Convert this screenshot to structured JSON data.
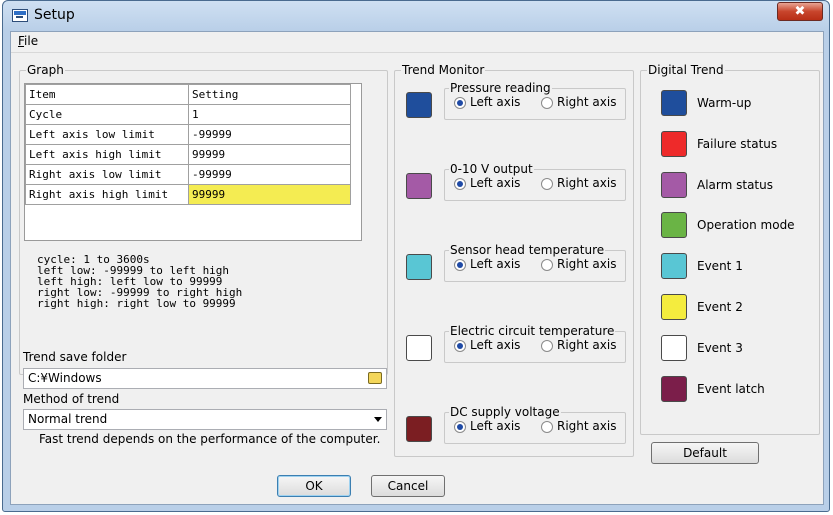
{
  "window": {
    "title": "Setup",
    "close_glyph": "✖"
  },
  "menu": {
    "file_accel": "F",
    "file_rest": "ile"
  },
  "graph": {
    "legend": "Graph",
    "columns": [
      "Item",
      "Setting"
    ],
    "rows": [
      {
        "item": "Cycle",
        "setting": "1"
      },
      {
        "item": "Left axis low limit",
        "setting": "-99999"
      },
      {
        "item": "Left axis high limit",
        "setting": "99999"
      },
      {
        "item": "Right axis low limit",
        "setting": "-99999"
      },
      {
        "item": "Right axis high limit",
        "setting": "99999"
      }
    ],
    "hint": "cycle: 1 to 3600s\nleft low: -99999 to left high\nleft high: left low to 99999\nright low: -99999 to right high\nright high: right low to 99999"
  },
  "trend_save_folder": {
    "label": "Trend save folder",
    "value": "C:¥Windows"
  },
  "method_of_trend": {
    "label": "Method of trend",
    "value": "Normal trend",
    "note": "Fast trend depends on the performance of the computer."
  },
  "trend_monitor": {
    "legend": "Trend Monitor",
    "left_label": "Left axis",
    "right_label": "Right axis",
    "items": [
      {
        "name": "Pressure reading",
        "color": "#1f4e9c",
        "axis": "left"
      },
      {
        "name": "0-10 V output",
        "color": "#a45aa6",
        "axis": "left"
      },
      {
        "name": "Sensor head temperature",
        "color": "#59c6d4",
        "axis": "left"
      },
      {
        "name": "Electric circuit temperature",
        "color": "#ffffff",
        "axis": "left"
      },
      {
        "name": "DC supply voltage",
        "color": "#7b1e22",
        "axis": "left"
      }
    ]
  },
  "digital_trend": {
    "legend": "Digital Trend",
    "items": [
      {
        "label": "Warm-up",
        "color": "#1f4e9c"
      },
      {
        "label": "Failure status",
        "color": "#ee2a2a"
      },
      {
        "label": "Alarm status",
        "color": "#a45aa6"
      },
      {
        "label": "Operation mode",
        "color": "#6ab445"
      },
      {
        "label": "Event 1",
        "color": "#59c6d4"
      },
      {
        "label": "Event 2",
        "color": "#f4ec3e"
      },
      {
        "label": "Event 3",
        "color": "#ffffff"
      },
      {
        "label": "Event latch",
        "color": "#7b1e4a"
      }
    ]
  },
  "buttons": {
    "default": "Default",
    "ok": "OK",
    "cancel": "Cancel"
  }
}
